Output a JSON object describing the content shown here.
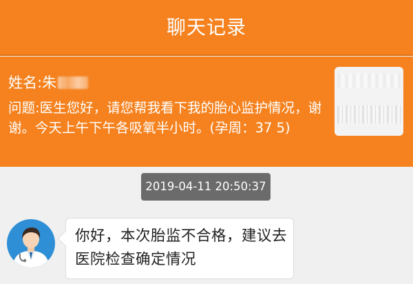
{
  "header": {
    "title": "聊天记录"
  },
  "patient": {
    "name_label": "姓名:朱",
    "question": "问题:医生您好，请您帮我看下我的胎心监护情况，谢谢。今天上午下午各吸氧半小时。(孕周：37 5)"
  },
  "thumbnail": {
    "icon": "fetal-monitor-report-thumbnail"
  },
  "chat": {
    "timestamp": "2019-04-11 20:50:37",
    "messages": [
      {
        "sender": "doctor",
        "avatar_icon": "doctor-avatar-icon",
        "text": "你好，本次胎监不合格，建议去医院检查确定情况"
      }
    ]
  },
  "colors": {
    "accent": "#f5821f",
    "timestamp_bg": "#6b6b6b",
    "avatar_bg": "#2e8fd6",
    "page_bg": "#f0f0f0"
  }
}
